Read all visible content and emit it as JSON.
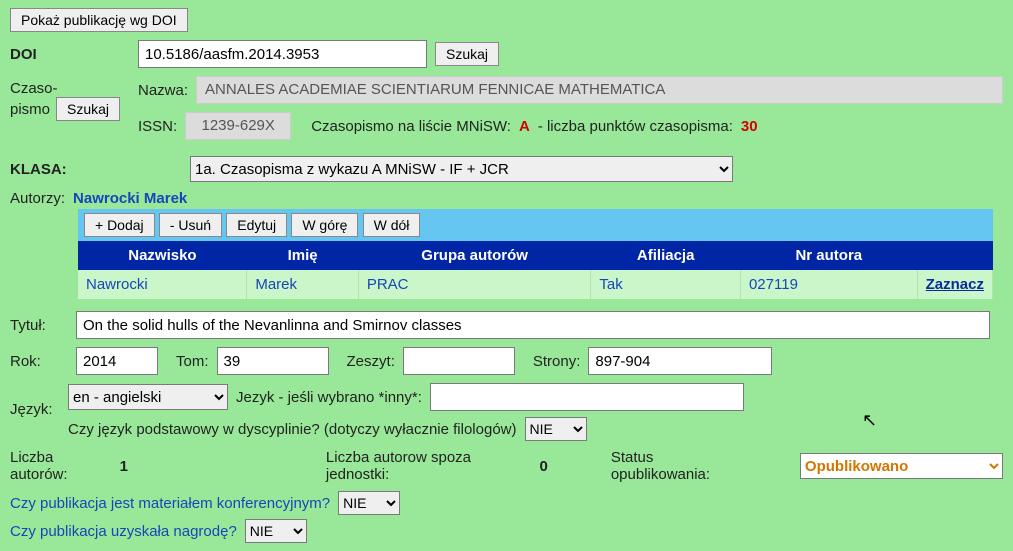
{
  "top": {
    "button_doi": "Pokaż publikację wg DOI"
  },
  "doi": {
    "label": "DOI",
    "value": "10.5186/aasfm.2014.3953",
    "search": "Szukaj"
  },
  "journal": {
    "label1": "Czaso-",
    "label2": "pismo",
    "search": "Szukaj",
    "name_label": "Nazwa:",
    "name": "ANNALES ACADEMIAE SCIENTIARUM FENNICAE MATHEMATICA",
    "issn_label": "ISSN:",
    "issn": "1239-629X",
    "mnisw_label": "Czasopismo na liście MNiSW:",
    "mnisw": "A",
    "points_label": "   - liczba punktów czasopisma:",
    "points": "30"
  },
  "klasa": {
    "label": "KLASA:",
    "value": "1a. Czasopisma z wykazu A MNiSW - IF + JCR"
  },
  "authors": {
    "label": "Autorzy:",
    "names": "Nawrocki Marek",
    "btn_add": "+ Dodaj",
    "btn_del": "- Usuń",
    "btn_edit": "Edytuj",
    "btn_up": "W górę",
    "btn_down": "W dół",
    "h_last": "Nazwisko",
    "h_first": "Imię",
    "h_group": "Grupa autorów",
    "h_aff": "Afiliacja",
    "h_num": "Nr autora",
    "row": {
      "last": "Nawrocki",
      "first": "Marek",
      "group": "PRAC",
      "aff": "Tak",
      "num": "027119",
      "mark": "Zaznacz"
    }
  },
  "title": {
    "label": "Tytuł:",
    "value": "On the solid hulls of the Nevanlinna and Smirnov classes"
  },
  "year": {
    "label": "Rok:",
    "value": "2014",
    "tom_label": "Tom:",
    "tom": "39",
    "zeszyt_label": "Zeszyt:",
    "zeszyt": "",
    "strony_label": "Strony:",
    "strony": "897-904"
  },
  "lang": {
    "label": "Język:",
    "value": "en - angielski",
    "other_label": "Jezyk - jeśli wybrano *inny*:",
    "other": "",
    "primary_label": "Czy język podstawowy w dyscyplinie? (dotyczy wyłacznie filologów)",
    "primary_value": "NIE"
  },
  "counts": {
    "total_label": "Liczba autorów:",
    "total": "1",
    "out_label": "Liczba autorow spoza jednostki:",
    "out": "0",
    "status_label": "Status opublikowania:",
    "status_value": "Opublikowano"
  },
  "conf": {
    "label": "Czy publikacja jest materiałem konferencyjnym?",
    "value": "NIE"
  },
  "award": {
    "label": "Czy publikacja uzyskała nagrodę?",
    "value": "NIE"
  }
}
